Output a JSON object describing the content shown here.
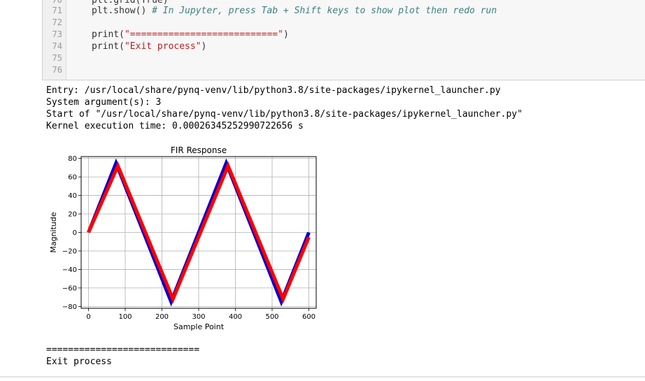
{
  "cell": {
    "lines": [
      {
        "num": "71",
        "pre": "plt.show() ",
        "comment": "# In Jupyter, press Tab + Shift keys to show plot then redo run",
        "str": "",
        "post": ""
      },
      {
        "num": "72",
        "pre": "",
        "comment": "",
        "str": "",
        "post": ""
      },
      {
        "num": "73",
        "pre": "print(",
        "comment": "",
        "str": "\"===========================\"",
        "post": ")"
      },
      {
        "num": "74",
        "pre": "print(",
        "comment": "",
        "str": "\"Exit process\"",
        "post": ")"
      },
      {
        "num": "75",
        "pre": "",
        "comment": "",
        "str": "",
        "post": ""
      },
      {
        "num": "76",
        "pre": "",
        "comment": "",
        "str": "",
        "post": ""
      }
    ]
  },
  "output": {
    "lines": [
      "Entry: /usr/local/share/pynq-venv/lib/python3.8/site-packages/ipykernel_launcher.py",
      "System argument(s): 3",
      "Start of \"/usr/local/share/pynq-venv/lib/python3.8/site-packages/ipykernel_launcher.py\"",
      "Kernel execution time: 0.00026345252990722656 s"
    ]
  },
  "chart_data": {
    "type": "line",
    "title": "FIR Response",
    "xlabel": "Sample Point",
    "ylabel": "Magnitude",
    "xlim": [
      -20,
      620
    ],
    "ylim": [
      -82,
      82
    ],
    "xticks": [
      0,
      100,
      200,
      300,
      400,
      500,
      600
    ],
    "yticks": [
      80,
      60,
      40,
      20,
      0,
      -20,
      -40,
      -60,
      -80
    ],
    "grid": true,
    "series": [
      {
        "color": "#0000cc",
        "x": [
          0,
          75,
          225,
          375,
          525,
          600
        ],
        "y": [
          0,
          75,
          -75,
          75,
          -75,
          0
        ]
      },
      {
        "color": "#ff0000",
        "x": [
          0,
          80,
          230,
          380,
          530,
          600
        ],
        "y": [
          0,
          72,
          -72,
          72,
          -72,
          -5
        ]
      }
    ]
  },
  "tail": {
    "separator": "============================",
    "message": "Exit process"
  }
}
